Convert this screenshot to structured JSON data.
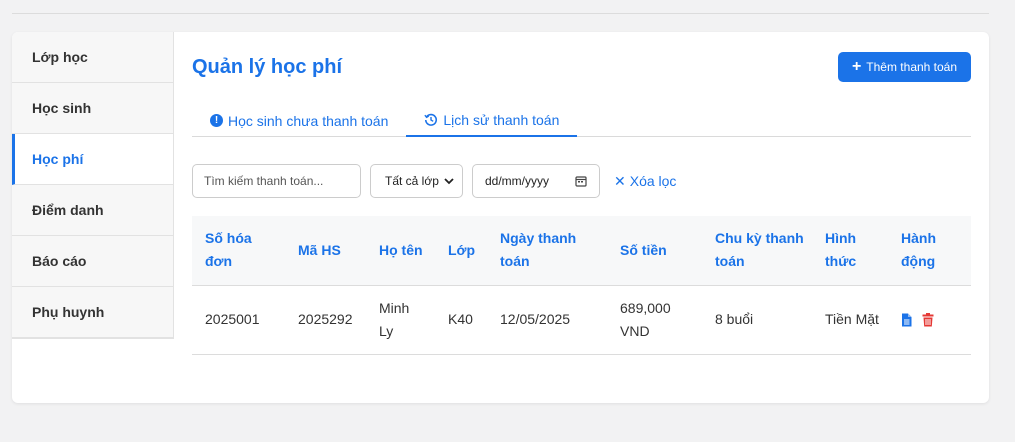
{
  "sidebar": {
    "items": [
      {
        "label": "Lớp học",
        "active": false
      },
      {
        "label": "Học sinh",
        "active": false
      },
      {
        "label": "Học phí",
        "active": true
      },
      {
        "label": "Điểm danh",
        "active": false
      },
      {
        "label": "Báo cáo",
        "active": false
      },
      {
        "label": "Phụ huynh",
        "active": false
      }
    ]
  },
  "header": {
    "title": "Quản lý học phí",
    "add_button": "Thêm thanh toán"
  },
  "tabs": [
    {
      "label": "Học sinh chưa thanh toán",
      "icon": "info-circle-icon"
    },
    {
      "label": "Lịch sử thanh toán",
      "icon": "history-icon",
      "active": true
    }
  ],
  "filters": {
    "search_placeholder": "Tìm kiếm thanh toán...",
    "class_select": "Tất cả lớp",
    "date_placeholder": "dd/mm/yyyy",
    "clear_label": "Xóa lọc"
  },
  "table": {
    "headers": [
      "Số hóa đơn",
      "Mã HS",
      "Họ tên",
      "Lớp",
      "Ngày thanh toán",
      "Số tiền",
      "Chu kỳ thanh toán",
      "Hình thức",
      "Hành động"
    ],
    "rows": [
      {
        "invoice": "2025001",
        "student_id": "2025292",
        "name": "Minh Ly",
        "class": "K40",
        "date": "12/05/2025",
        "amount": "689,000 VND",
        "cycle": "8 buổi",
        "method": "Tiền Mặt"
      }
    ]
  },
  "colors": {
    "accent": "#1b73e8",
    "danger": "#e53935"
  }
}
